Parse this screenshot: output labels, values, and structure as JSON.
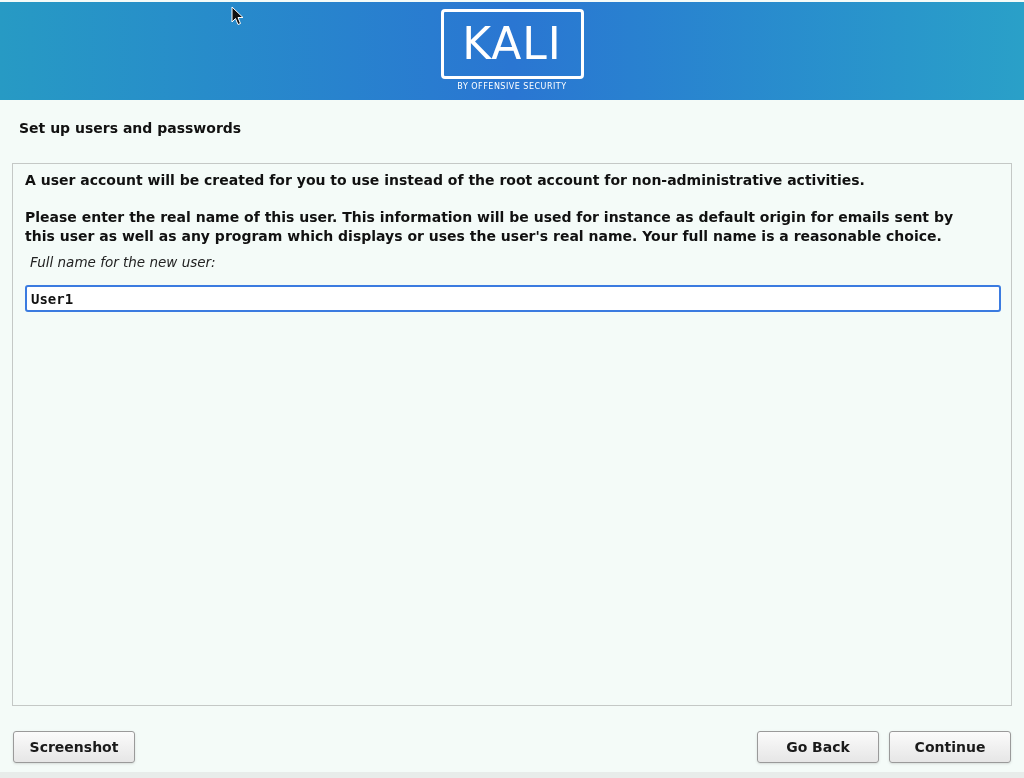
{
  "header": {
    "logo": {
      "wordmark": "KALI",
      "tagline": "BY OFFENSIVE SECURITY"
    }
  },
  "title": "Set up users and passwords",
  "paragraphs": [
    "A user account will be created for you to use instead of the root account for non-administrative activities.",
    "Please enter the real name of this user. This information will be used for instance as default origin for emails sent by this user as well as any program which displays or uses the user's real name. Your full name is a reasonable choice."
  ],
  "field": {
    "label": "Full name for the new user:",
    "value": "User1"
  },
  "buttons": {
    "left": [
      "Screenshot"
    ],
    "right": [
      "Go Back",
      "Continue"
    ]
  }
}
